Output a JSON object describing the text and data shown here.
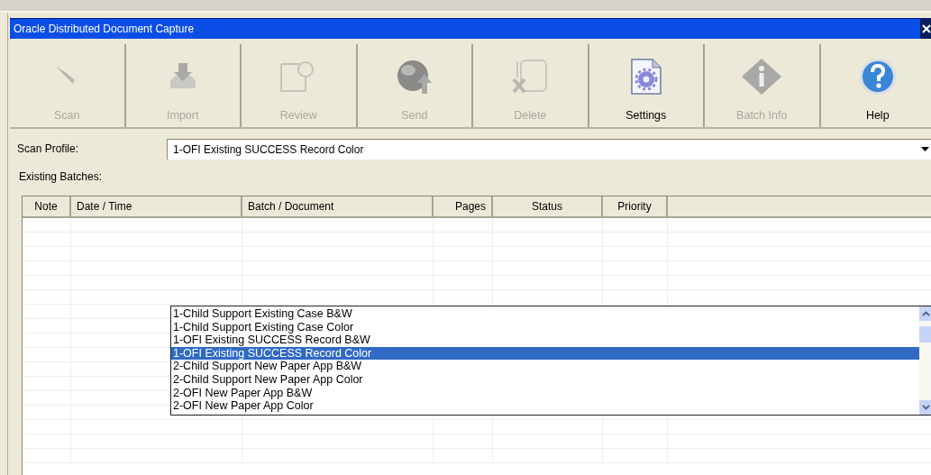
{
  "window": {
    "title": "Oracle Distributed Document Capture"
  },
  "toolbar": [
    {
      "label": "Scan",
      "kind": "scan",
      "disabled": true
    },
    {
      "label": "Import",
      "kind": "import",
      "disabled": true
    },
    {
      "label": "Review",
      "kind": "review",
      "disabled": true
    },
    {
      "label": "Send",
      "kind": "send",
      "disabled": true
    },
    {
      "label": "Delete",
      "kind": "delete",
      "disabled": true
    },
    {
      "label": "Settings",
      "kind": "settings",
      "disabled": false
    },
    {
      "label": "Batch Info",
      "kind": "info",
      "disabled": true
    },
    {
      "label": "Help",
      "kind": "help",
      "disabled": false
    }
  ],
  "scan_profile": {
    "label": "Scan Profile:",
    "value": "1-OFI Existing SUCCESS Record Color",
    "expanded": true,
    "options": [
      {
        "label": "1-Child Support Existing Case B&W",
        "selected": false
      },
      {
        "label": "1-Child Support Existing Case Color",
        "selected": false
      },
      {
        "label": "1-OFI Existing SUCCESS Record B&W",
        "selected": false
      },
      {
        "label": "1-OFI Existing SUCCESS Record Color",
        "selected": true
      },
      {
        "label": "2-Child Support New Paper App B&W",
        "selected": false
      },
      {
        "label": "2-Child Support New Paper App Color",
        "selected": false
      },
      {
        "label": "2-OFI New Paper App B&W",
        "selected": false
      },
      {
        "label": "2-OFI New Paper App Color",
        "selected": false
      }
    ]
  },
  "batches": {
    "label": "Existing Batches:",
    "columns": [
      {
        "label": "Note"
      },
      {
        "label": "Date / Time"
      },
      {
        "label": "Batch / Document"
      },
      {
        "label": "Pages"
      },
      {
        "label": "Status"
      },
      {
        "label": "Priority"
      }
    ]
  }
}
